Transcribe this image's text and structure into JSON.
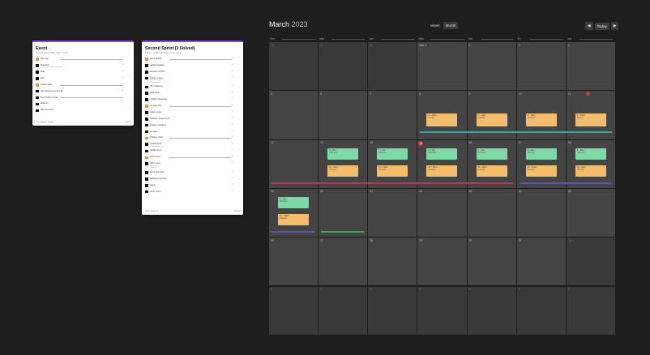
{
  "event_card": {
    "title": "Event",
    "subtitle": "Created 2 Mar 2023 · 9:00 – 17:00",
    "rows": [
      {
        "color": "orange",
        "text": "Plan day",
        "strike": true,
        "note": "",
        "icons": [
          "↻",
          "⋯"
        ]
      },
      {
        "color": "black",
        "text": "Research",
        "strike": false,
        "note": "Collect notes from last week",
        "icons": [
          "↻",
          "⋯"
        ]
      },
      {
        "color": "black",
        "text": "Write",
        "strike": false,
        "note": "",
        "icons": [
          "↻",
          "⋯"
        ]
      },
      {
        "color": "black",
        "text": "Edit",
        "strike": false,
        "note": "",
        "icons": [
          "↻",
          "⋯"
        ]
      },
      {
        "color": "orange",
        "text": "Review draft",
        "strike": true,
        "note": "",
        "icons": [
          "↻",
          "⋯"
        ]
      },
      {
        "color": "black",
        "text": "Add references and links",
        "strike": false,
        "note": "",
        "icons": [
          "↻",
          "⋯"
        ]
      },
      {
        "color": "black",
        "text": "Send notes to team",
        "strike": true,
        "note": "",
        "icons": [
          "↻",
          "⋯"
        ]
      },
      {
        "color": "black",
        "text": "Wrap up",
        "strike": false,
        "note": "",
        "icons": [
          "↻",
          "⋯"
        ]
      },
      {
        "color": "black",
        "text": "Plan tomorrow",
        "strike": false,
        "note": "",
        "icons": [
          "↻",
          "⋯"
        ]
      }
    ],
    "footer_left": "Last updated 12 Mar",
    "footer_right": "Done"
  },
  "sprint_card": {
    "title": "Second Sprint (3 Solved)",
    "subtitle": "1 Mar – 14 Mar · 24 tasks in this sprint",
    "rows": [
      {
        "color": "orange",
        "text": "Sprint kickoff",
        "strike": true,
        "note": "",
        "icons": [
          "↻",
          "⋯"
        ]
      },
      {
        "color": "black",
        "text": "Update backlog",
        "strike": false,
        "note": "",
        "icons": [
          "↻",
          "⋯"
        ]
      },
      {
        "color": "black",
        "text": "Estimate stories",
        "strike": false,
        "note": "",
        "icons": [
          "↻",
          "⋯"
        ]
      },
      {
        "color": "black",
        "text": "Design review",
        "strike": false,
        "note": "Share mockups\nGet feedback",
        "icons": [
          "↻",
          "⋯"
        ]
      },
      {
        "color": "black",
        "text": "API endpoints",
        "strike": false,
        "note": "",
        "icons": [
          "↻",
          "⋯"
        ]
      },
      {
        "color": "black",
        "text": "Write tests",
        "strike": false,
        "note": "",
        "icons": [
          "↻",
          "⋯"
        ]
      },
      {
        "color": "black",
        "text": "Update changelog",
        "strike": false,
        "note": "",
        "icons": [
          "↻",
          "⋯"
        ]
      },
      {
        "color": "orange",
        "text": "Fix login bug",
        "strike": true,
        "note": "",
        "icons": [
          "↻",
          "⋯"
        ]
      },
      {
        "color": "black",
        "text": "Code review",
        "strike": false,
        "note": "",
        "icons": [
          "↻",
          "⋯"
        ]
      },
      {
        "color": "black",
        "text": "Refactor components",
        "strike": false,
        "note": "",
        "icons": [
          "↻",
          "⋯"
        ]
      },
      {
        "color": "black",
        "text": "Deploy to staging",
        "strike": false,
        "note": "",
        "icons": [
          "↻",
          "⋯"
        ]
      },
      {
        "color": "black",
        "text": "QA pass",
        "strike": false,
        "note": "",
        "icons": [
          "↻",
          "⋯"
        ]
      },
      {
        "color": "orange",
        "text": "Release notes",
        "strike": true,
        "note": "",
        "icons": [
          "↻",
          "⋯"
        ]
      },
      {
        "color": "black",
        "text": "Performance",
        "strike": false,
        "note": "Profile slow pages",
        "icons": [
          "↻",
          "⋯"
        ]
      },
      {
        "color": "black",
        "text": "Update docs",
        "strike": false,
        "note": "",
        "icons": [
          "↻",
          "⋯"
        ]
      },
      {
        "color": "orange",
        "text": "Demo prep",
        "strike": true,
        "note": "",
        "icons": [
          "↻",
          "⋯"
        ]
      },
      {
        "color": "black",
        "text": "Retro notes",
        "strike": false,
        "note": "Action items\nFollow up",
        "icons": [
          "↻",
          "⋯"
        ]
      },
      {
        "color": "black",
        "text": "Sprint planning",
        "strike": false,
        "note": "",
        "icons": [
          "↻",
          "⋯"
        ]
      },
      {
        "color": "black",
        "text": "Backlog grooming",
        "strike": false,
        "note": "",
        "icons": [
          "↻",
          "⋯"
        ]
      },
      {
        "color": "black",
        "text": "Triage",
        "strike": false,
        "note": "",
        "icons": [
          "↻",
          "⋯"
        ]
      },
      {
        "color": "black",
        "text": "Close sprint",
        "strike": false,
        "note": "",
        "icons": [
          "↻",
          "⋯"
        ]
      }
    ],
    "footer_left": "Sprint progress",
    "footer_right": "Details"
  },
  "calendar": {
    "month": "March",
    "year": "2023",
    "view_week": "Week",
    "view_month": "Month",
    "prev": "◀",
    "today_btn": "Today",
    "next": "▶",
    "weekdays": [
      "Sun",
      "Mon",
      "Tue",
      "Wed",
      "Thu",
      "Fri",
      "Sat"
    ],
    "weeks": [
      [
        {
          "d": "26",
          "out": true
        },
        {
          "d": "27",
          "out": true
        },
        {
          "d": "28",
          "out": true
        },
        {
          "d": "Mar 1"
        },
        {
          "d": "2"
        },
        {
          "d": "3"
        },
        {
          "d": "4"
        }
      ],
      [
        {
          "d": "5"
        },
        {
          "d": "6"
        },
        {
          "d": "7"
        },
        {
          "d": "8"
        },
        {
          "d": "9"
        },
        {
          "d": "10"
        },
        {
          "d": "11"
        }
      ],
      [
        {
          "d": "12"
        },
        {
          "d": "13"
        },
        {
          "d": "14"
        },
        {
          "d": "15",
          "today": true
        },
        {
          "d": "16"
        },
        {
          "d": "17"
        },
        {
          "d": "18"
        }
      ],
      [
        {
          "d": "19"
        },
        {
          "d": "20"
        },
        {
          "d": "21"
        },
        {
          "d": "22"
        },
        {
          "d": "23"
        },
        {
          "d": "24"
        },
        {
          "d": "25"
        }
      ],
      [
        {
          "d": "26"
        },
        {
          "d": "27"
        },
        {
          "d": "28"
        },
        {
          "d": "29"
        },
        {
          "d": "30"
        },
        {
          "d": "31"
        },
        {
          "d": "Apr 1",
          "out": true
        }
      ],
      [
        {
          "d": "2",
          "out": true
        },
        {
          "d": "3",
          "out": true
        },
        {
          "d": "4",
          "out": true
        },
        {
          "d": "5",
          "out": true
        },
        {
          "d": "6",
          "out": true
        },
        {
          "d": "7",
          "out": true
        },
        {
          "d": "8",
          "out": true
        }
      ]
    ],
    "events": [
      {
        "week": 1,
        "day": 3,
        "slot": 0,
        "color": "o",
        "t1": "9 – 10am",
        "t2": "Design"
      },
      {
        "week": 1,
        "day": 4,
        "slot": 0,
        "color": "o",
        "t1": "9 – 10am",
        "t2": "Standup"
      },
      {
        "week": 1,
        "day": 5,
        "slot": 0,
        "color": "o",
        "t1": "9 – 10am",
        "t2": "Standup"
      },
      {
        "week": 1,
        "day": 6,
        "slot": 0,
        "color": "o",
        "t1": "9 – 10am",
        "t2": "Review"
      },
      {
        "week": 2,
        "day": 1,
        "slot": 0,
        "color": "g",
        "t1": "8 – 9am",
        "t2": "Planning"
      },
      {
        "week": 2,
        "day": 2,
        "slot": 0,
        "color": "g",
        "t1": "8 – 9am",
        "t2": "Planning"
      },
      {
        "week": 2,
        "day": 3,
        "slot": 0,
        "color": "g",
        "t1": "8 – 9am",
        "t2": "Planning"
      },
      {
        "week": 2,
        "day": 4,
        "slot": 0,
        "color": "g",
        "t1": "8 – 9am",
        "t2": "Planning"
      },
      {
        "week": 2,
        "day": 5,
        "slot": 0,
        "color": "g",
        "t1": "8 – 9am",
        "t2": "Planning"
      },
      {
        "week": 2,
        "day": 6,
        "slot": 0,
        "color": "g",
        "t1": "8 – 9am",
        "t2": "Planning"
      },
      {
        "week": 2,
        "day": 1,
        "slot": 1,
        "color": "o",
        "t1": "10 – 11am",
        "t2": "Standup"
      },
      {
        "week": 2,
        "day": 2,
        "slot": 1,
        "color": "o",
        "t1": "10 – 11am",
        "t2": "Standup"
      },
      {
        "week": 2,
        "day": 3,
        "slot": 1,
        "color": "o",
        "t1": "10 – 11am",
        "t2": "Standup"
      },
      {
        "week": 2,
        "day": 4,
        "slot": 1,
        "color": "o",
        "t1": "10 – 11am",
        "t2": "Standup"
      },
      {
        "week": 2,
        "day": 5,
        "slot": 1,
        "color": "o",
        "t1": "10 – 11am",
        "t2": "Standup"
      },
      {
        "week": 2,
        "day": 6,
        "slot": 1,
        "color": "o",
        "t1": "10 – 11am",
        "t2": "Standup"
      },
      {
        "week": 3,
        "day": 0,
        "slot": 0,
        "color": "g",
        "t1": "8 – 9am",
        "t2": "Planning"
      },
      {
        "week": 3,
        "day": 0,
        "slot": 1,
        "color": "o",
        "t1": "10 – 11am",
        "t2": "Standup"
      }
    ],
    "bars": [
      {
        "week": 1,
        "from": 3,
        "to": 6,
        "color": "#3aa6a6"
      },
      {
        "week": 2,
        "from": 0,
        "to": 4,
        "color": "#b03a5a"
      },
      {
        "week": 2,
        "from": 5,
        "to": 6,
        "color": "#6a4fb0"
      },
      {
        "week": 3,
        "from": 0,
        "to": 0,
        "color": "#6a4fb0"
      },
      {
        "week": 3,
        "from": 1,
        "to": 1,
        "color": "#3aa65a"
      }
    ]
  }
}
